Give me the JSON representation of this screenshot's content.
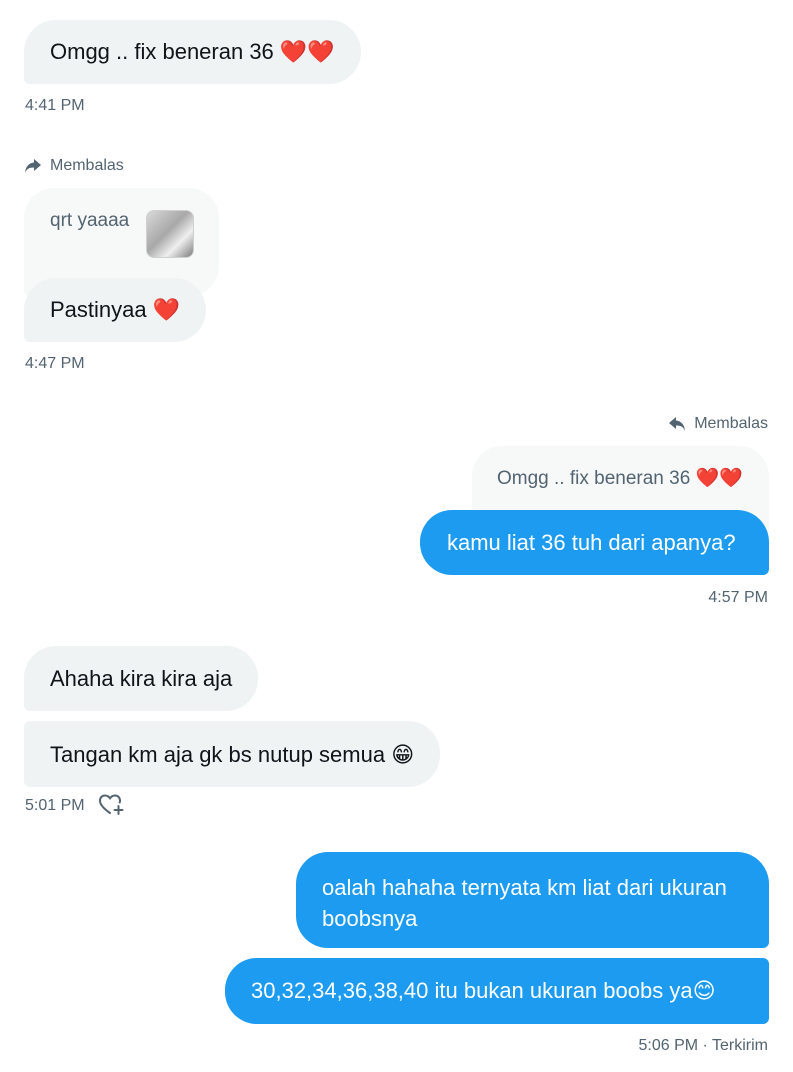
{
  "messages": {
    "m1": {
      "text": "Omgg .. fix beneran 36 ❤️❤️",
      "time": "4:41 PM"
    },
    "m2": {
      "reply_label": "Membalas",
      "quote_text": "qrt yaaaa",
      "text": "Pastinyaa ❤️",
      "time": "4:47 PM"
    },
    "m3": {
      "reply_label": "Membalas",
      "quote_text": "Omgg .. fix beneran 36 ❤️❤️",
      "text": "kamu liat 36 tuh dari apanya?",
      "time": "4:57 PM"
    },
    "m4": {
      "text1": "Ahaha kira kira aja",
      "text2": "Tangan km aja gk bs nutup semua 😁",
      "time": "5:01 PM"
    },
    "m5": {
      "text1_line1": "oalah hahaha ternyata km liat dari ukuran",
      "text1_line2": "boobsnya",
      "text2": "30,32,34,36,38,40 itu bukan ukuran boobs ya😊",
      "time": "5:06 PM · Terkirim"
    }
  },
  "colors": {
    "incoming_bubble": "#eff3f4",
    "outgoing_bubble": "#1d9bf0",
    "secondary_text": "#536471"
  },
  "icons": {
    "reply_incoming": "share-arrow-icon",
    "reply_outgoing": "reply-arrow-icon",
    "react": "heart-plus-icon"
  }
}
